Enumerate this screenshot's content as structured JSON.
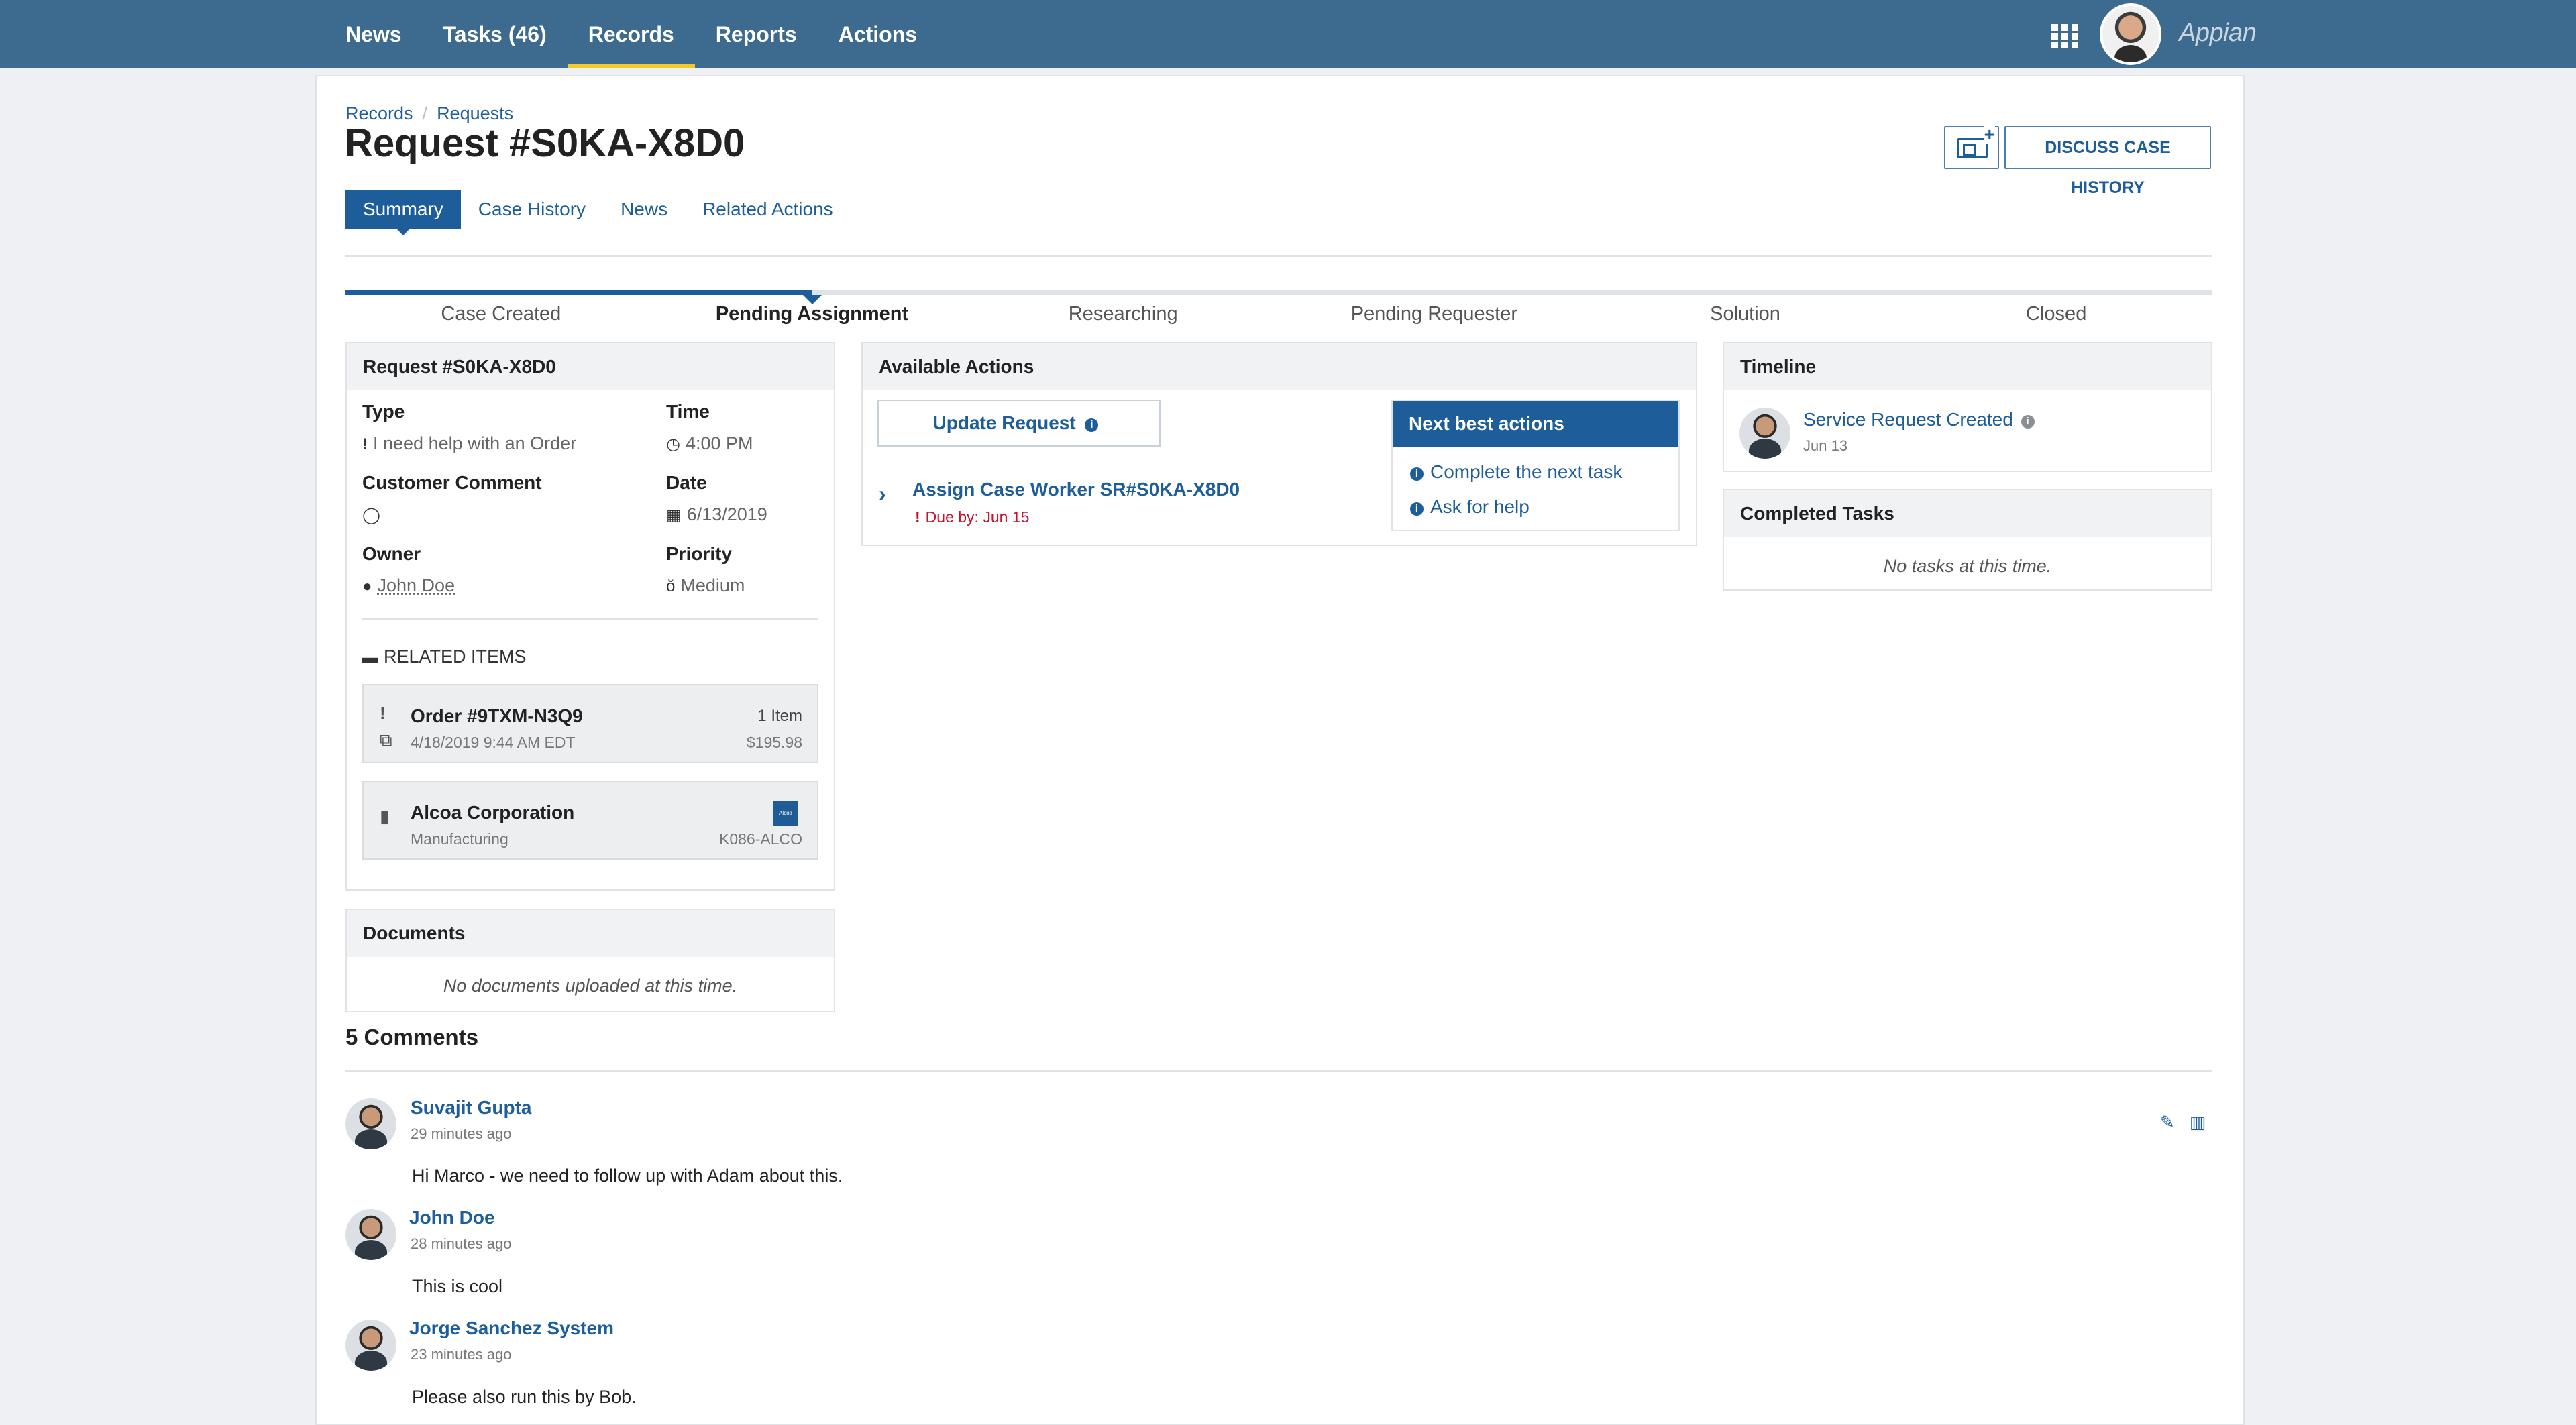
{
  "nav": {
    "items": [
      {
        "label": "News"
      },
      {
        "label": "Tasks (46)"
      },
      {
        "label": "Records"
      },
      {
        "label": "Reports"
      },
      {
        "label": "Actions"
      }
    ],
    "active": "Records",
    "brand": "Appian"
  },
  "breadcrumb": [
    "Records",
    "Requests"
  ],
  "page_title": "Request #S0KA-X8D0",
  "header_buttons": {
    "discuss": "DISCUSS CASE HISTORY"
  },
  "tabs": [
    "Summary",
    "Case History",
    "News",
    "Related Actions"
  ],
  "active_tab": "Summary",
  "stages": {
    "labels": [
      "Case Created",
      "Pending Assignment",
      "Researching",
      "Pending Requester",
      "Solution",
      "Closed"
    ],
    "current": "Pending Assignment",
    "progress_fraction": 0.25
  },
  "details": {
    "header": "Request #S0KA-X8D0",
    "type_label": "Type",
    "type_value": "I need help with an Order",
    "time_label": "Time",
    "time_value": "4:00 PM",
    "comment_label": "Customer Comment",
    "date_label": "Date",
    "date_value": "6/13/2019",
    "owner_label": "Owner",
    "owner_value": "John Doe",
    "priority_label": "Priority",
    "priority_value": "Medium",
    "related_title": "RELATED ITEMS",
    "related": [
      {
        "title": "Order #9TXM-N3Q9",
        "sub": "4/18/2019 9:44 AM EDT",
        "right": "1 Item",
        "right_sub": "$195.98"
      },
      {
        "title": "Alcoa Corporation",
        "sub": "Manufacturing",
        "right": "",
        "right_sub": "K086-ALCO",
        "logo_text": "Alcoa"
      }
    ]
  },
  "documents": {
    "header": "Documents",
    "empty": "No documents uploaded at this time."
  },
  "available_actions": {
    "header": "Available Actions",
    "update_button": "Update Request",
    "task_link": "Assign Case Worker SR#S0KA-X8D0",
    "due": "Due by: Jun 15"
  },
  "next_best_actions": {
    "header": "Next best actions",
    "items": [
      "Complete the next task",
      "Ask for help"
    ]
  },
  "timeline": {
    "header": "Timeline",
    "event": "Service Request Created",
    "date": "Jun 13"
  },
  "completed_tasks": {
    "header": "Completed Tasks",
    "empty": "No tasks at this time."
  },
  "comments": {
    "title": "5 Comments",
    "items": [
      {
        "name": "Suvajit Gupta",
        "time": "29 minutes ago",
        "text": "Hi Marco - we need to follow up with Adam about this."
      },
      {
        "name": "John Doe",
        "time": "28 minutes ago",
        "text": "This is cool"
      },
      {
        "name": "Jorge Sanchez System",
        "time": "23 minutes ago",
        "text": "Please also run this by Bob."
      }
    ]
  },
  "colors": {
    "topbar": "#3d6a8f",
    "accent": "#1d5e9a",
    "active_underline": "#f3c928",
    "due_red": "#c8102e"
  }
}
